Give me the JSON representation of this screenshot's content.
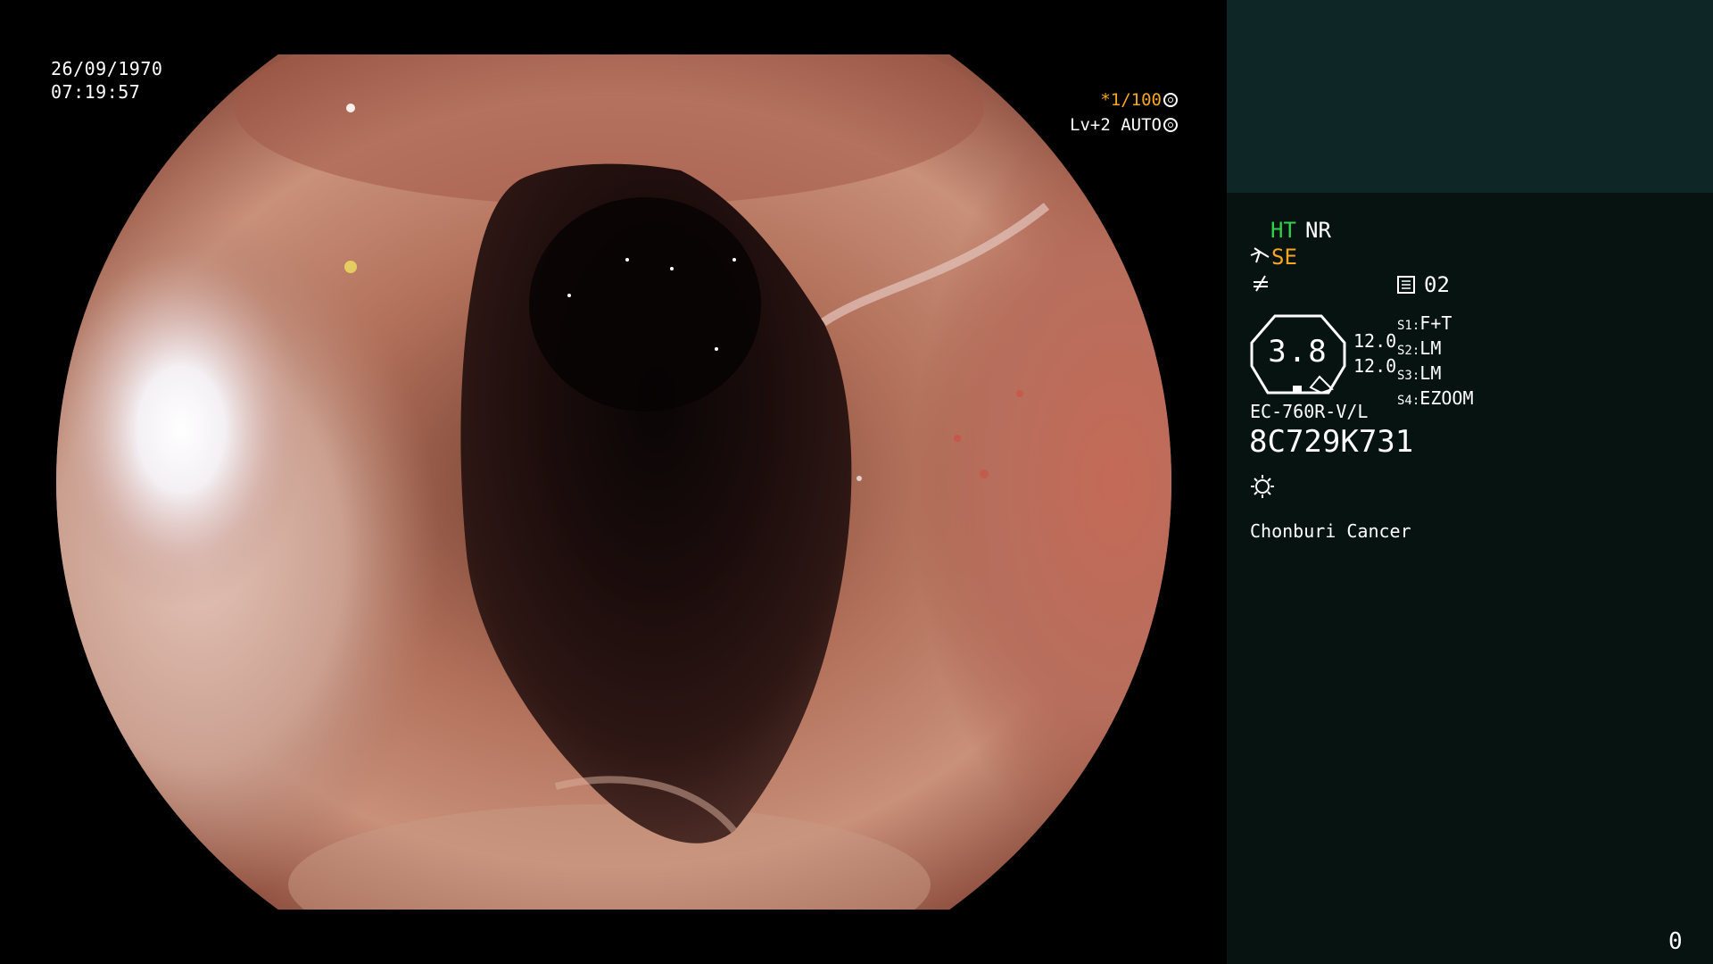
{
  "overlay": {
    "date": "26/09/1970",
    "time": "07:19:57",
    "shutter_speed": "*1/100",
    "level": "Lv+2 AUTO"
  },
  "panel": {
    "mode_ht": "HT",
    "mode_nr": "NR",
    "mode_se": "SE",
    "memory_id": "02",
    "zoom": "3.8",
    "scale_top": "12.0",
    "scale_bottom": "12.0",
    "settings": [
      {
        "label": "S1:",
        "value": "F+T"
      },
      {
        "label": "S2:",
        "value": "LM"
      },
      {
        "label": "S3:",
        "value": "LM"
      },
      {
        "label": "S4:",
        "value": "EZOOM"
      }
    ],
    "scope_model": "EC-760R-V/L",
    "scope_serial": "8C729K731",
    "institution": "Chonburi Cancer",
    "counter": "0"
  },
  "colors": {
    "panel_bg": "#061311",
    "panel_top_bg": "#0e2726",
    "ht_green": "#33d04a",
    "se_orange": "#f5a623"
  },
  "icons": [
    "camera-shutter-icon",
    "iris-icon",
    "scope-tip-icon",
    "no-signal-icon",
    "memory-card-icon",
    "light-source-icon"
  ]
}
